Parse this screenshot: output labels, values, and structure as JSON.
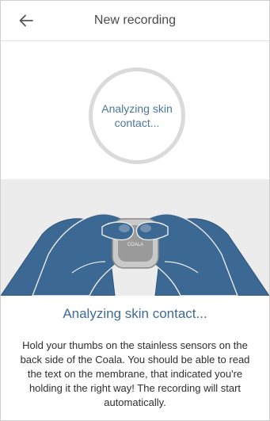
{
  "header": {
    "title": "New recording",
    "back_icon": "arrow-left-icon"
  },
  "status": {
    "ring_text": "Analyzing skin contact..."
  },
  "illustration": {
    "device_label": "COALA"
  },
  "instructions": {
    "heading": "Analyzing skin contact...",
    "body": "Hold your thumbs on the stainless sensors on the back side of the Coala. You should be able to read the text on the membrane, that indicated you're holding it the right way! The recording will start automatically."
  },
  "colors": {
    "accent": "#3f6b96",
    "hand": "#3c6993",
    "ring": "#dadada",
    "illustration_bg": "#ececec"
  }
}
